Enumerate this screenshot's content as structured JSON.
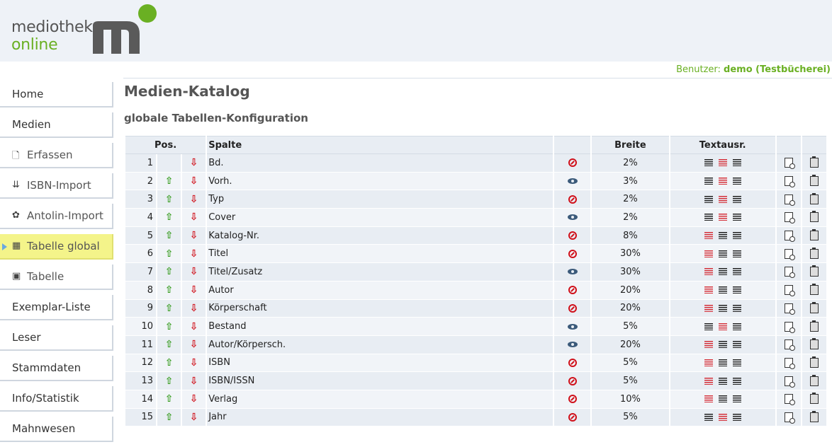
{
  "brand": {
    "line1": "mediothek",
    "line2": "online",
    "mark": "m"
  },
  "user": {
    "label": "Benutzer:",
    "name": "demo (Testbücherei)"
  },
  "sidebar": {
    "items": [
      {
        "label": "Home",
        "type": "main"
      },
      {
        "label": "Medien",
        "type": "main"
      },
      {
        "label": "Erfassen",
        "type": "sub",
        "icon": "document-icon"
      },
      {
        "label": "ISBN-Import",
        "type": "sub",
        "icon": "import-icon"
      },
      {
        "label": "Antolin-Import",
        "type": "sub",
        "icon": "tree-icon"
      },
      {
        "label": "Tabelle global",
        "type": "sub",
        "icon": "table-icon",
        "active": true
      },
      {
        "label": "Tabelle",
        "type": "sub",
        "icon": "table-edit-icon"
      },
      {
        "label": "Exemplar-Liste",
        "type": "main"
      },
      {
        "label": "Leser",
        "type": "main"
      },
      {
        "label": "Stammdaten",
        "type": "main"
      },
      {
        "label": "Info/Statistik",
        "type": "main"
      },
      {
        "label": "Mahnwesen",
        "type": "main"
      }
    ]
  },
  "main": {
    "title": "Medien-Katalog",
    "subtitle": "globale Tabellen-Konfiguration",
    "columns": {
      "pos": "Pos.",
      "spalte": "Spalte",
      "breite": "Breite",
      "textausr": "Textausr."
    },
    "rows": [
      {
        "pos": "1",
        "name": "Bd.",
        "visible": false,
        "width": "2%",
        "align": "center",
        "up": false
      },
      {
        "pos": "2",
        "name": "Vorh.",
        "visible": true,
        "width": "3%",
        "align": "center",
        "up": true
      },
      {
        "pos": "3",
        "name": "Typ",
        "visible": false,
        "width": "2%",
        "align": "center",
        "up": true
      },
      {
        "pos": "4",
        "name": "Cover",
        "visible": true,
        "width": "2%",
        "align": "center",
        "up": true
      },
      {
        "pos": "5",
        "name": "Katalog-Nr.",
        "visible": false,
        "width": "8%",
        "align": "left",
        "up": true
      },
      {
        "pos": "6",
        "name": "Titel",
        "visible": false,
        "width": "30%",
        "align": "left",
        "up": true
      },
      {
        "pos": "7",
        "name": "Titel/Zusatz",
        "visible": true,
        "width": "30%",
        "align": "left",
        "up": true
      },
      {
        "pos": "8",
        "name": "Autor",
        "visible": false,
        "width": "20%",
        "align": "left",
        "up": true
      },
      {
        "pos": "9",
        "name": "Körperschaft",
        "visible": false,
        "width": "20%",
        "align": "left",
        "up": true
      },
      {
        "pos": "10",
        "name": "Bestand",
        "visible": true,
        "width": "5%",
        "align": "center",
        "up": true
      },
      {
        "pos": "11",
        "name": "Autor/Körpersch.",
        "visible": true,
        "width": "20%",
        "align": "left",
        "up": true
      },
      {
        "pos": "12",
        "name": "ISBN",
        "visible": false,
        "width": "5%",
        "align": "left",
        "up": true
      },
      {
        "pos": "13",
        "name": "ISBN/ISSN",
        "visible": false,
        "width": "5%",
        "align": "left",
        "up": true
      },
      {
        "pos": "14",
        "name": "Verlag",
        "visible": false,
        "width": "10%",
        "align": "left",
        "up": true
      },
      {
        "pos": "15",
        "name": "Jahr",
        "visible": false,
        "width": "5%",
        "align": "center",
        "up": true
      }
    ]
  },
  "colors": {
    "accent": "#6ab023",
    "header_bg": "#eef2f7",
    "row_odd": "#e8edf3",
    "active_nav": "#f4f48a"
  }
}
